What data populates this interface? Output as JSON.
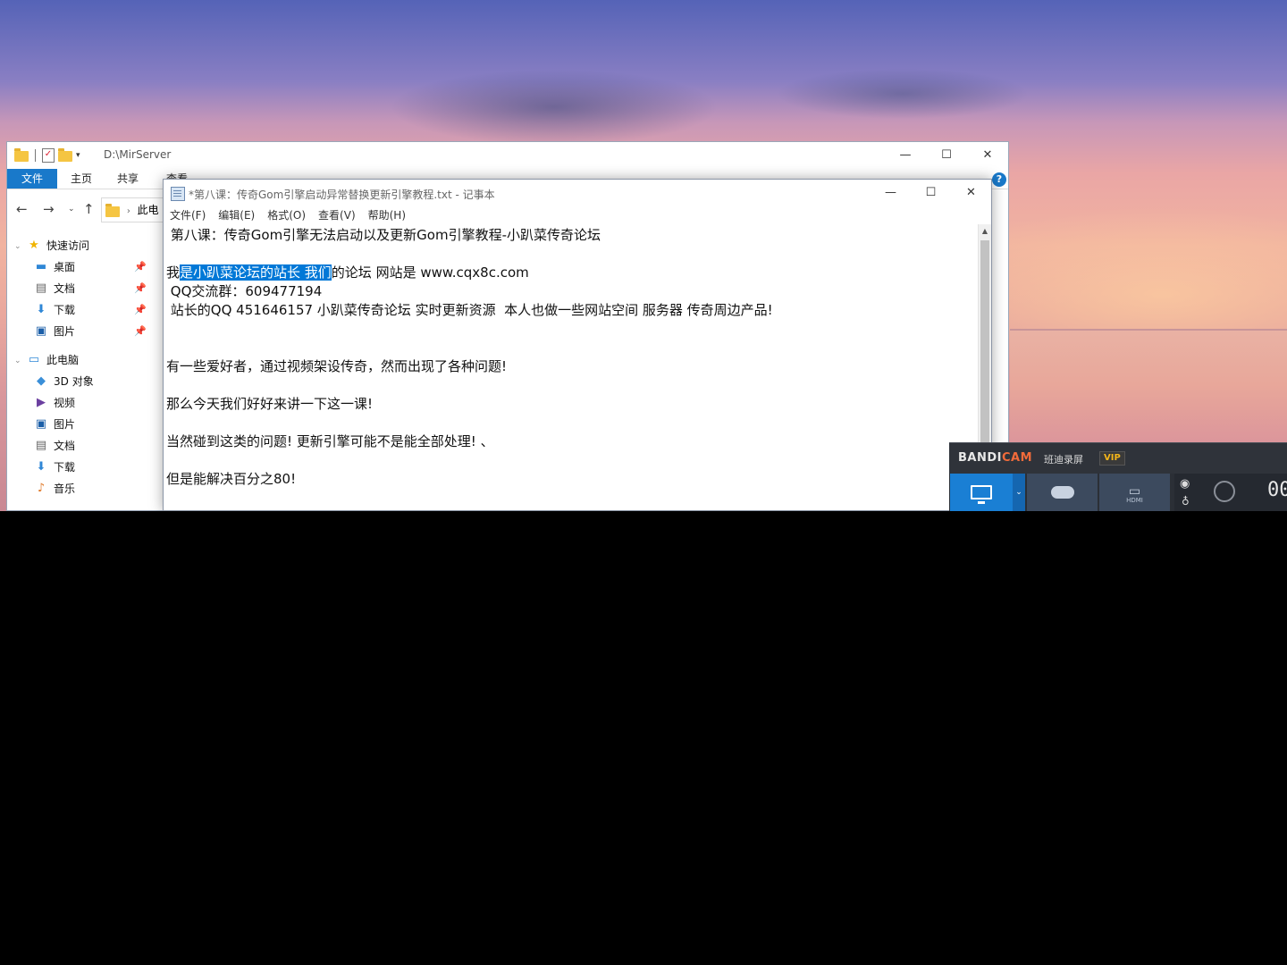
{
  "explorer": {
    "path_title": "D:\\MirServer",
    "ribbon_tabs": [
      "文件",
      "主页",
      "共享",
      "查看"
    ],
    "address_fragment": "此电",
    "window_controls": {
      "minimize": "—",
      "maximize": "☐",
      "close": "✕"
    },
    "sidebar": {
      "quick_access": "快速访问",
      "quick_items": [
        "桌面",
        "文档",
        "下载",
        "图片"
      ],
      "this_pc": "此电脑",
      "pc_items": [
        "3D 对象",
        "视频",
        "图片",
        "文档",
        "下载",
        "音乐"
      ]
    }
  },
  "notepad": {
    "title": "*第八课：传奇Gom引擎启动异常替换更新引擎教程.txt - 记事本",
    "menu": [
      "文件(F)",
      "编辑(E)",
      "格式(O)",
      "查看(V)",
      "帮助(H)"
    ],
    "window_controls": {
      "minimize": "—",
      "maximize": "☐",
      "close": "✕"
    },
    "lines": {
      "l1": " 第八课：传奇Gom引擎无法启动以及更新Gom引擎教程-小趴菜传奇论坛",
      "l2_pre": "我",
      "l2_sel": "是小趴菜论坛的站长 我们",
      "l2_post": "的论坛 网站是 www.cqx8c.com",
      "l3": " QQ交流群：609477194",
      "l4": " 站长的QQ 451646157 小趴菜传奇论坛 实时更新资源  本人也做一些网站空间 服务器 传奇周边产品!",
      "l5": "有一些爱好者，通过视频架设传奇，然而出现了各种问题!",
      "l6": "那么今天我们好好来讲一下这一课!",
      "l7": "当然碰到这类的问题! 更新引擎可能不是能全部处理! 、",
      "l8": "但是能解决百分之80!"
    }
  },
  "bandicam": {
    "logo_a": "BANDI",
    "logo_b": "CAM",
    "name": "班迪录屏",
    "vip": "VIP",
    "hdmi": "HDMI",
    "timer": "00"
  },
  "colors": {
    "selection": "#0078d7",
    "ribbon_active": "#1979ca",
    "bandicam_accent": "#f26b3a"
  }
}
